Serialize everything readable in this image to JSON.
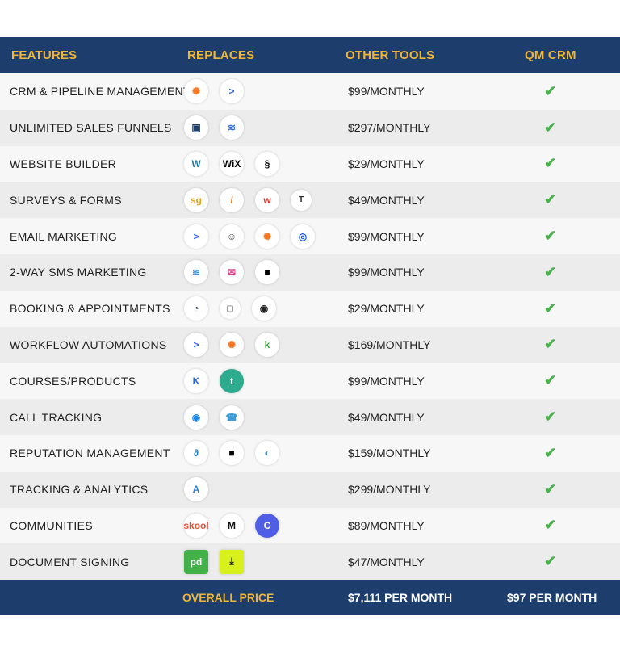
{
  "header": {
    "features": "FEATURES",
    "replaces": "REPLACES",
    "other_tools": "OTHER TOOLS",
    "qm_crm": "QM CRM"
  },
  "colors": {
    "navy": "#1d3d6c",
    "gold": "#f2b632",
    "check": "#4caf50"
  },
  "rows": [
    {
      "feature": "CRM & PIPELINE MANAGEMENT",
      "price": "$99/MONTHLY",
      "icons": [
        "hubspot-icon",
        "activecampaign-icon"
      ]
    },
    {
      "feature": "UNLIMITED SALES FUNNELS",
      "price": "$297/MONTHLY",
      "icons": [
        "clickfunnels-icon",
        "leadpages-icon"
      ]
    },
    {
      "feature": "WEBSITE BUILDER",
      "price": "$29/MONTHLY",
      "icons": [
        "wordpress-icon",
        "wix-icon",
        "squarespace-icon"
      ]
    },
    {
      "feature": "SURVEYS & FORMS",
      "price": "$49/MONTHLY",
      "icons": [
        "surveygizmo-icon",
        "jotform-icon",
        "wufoo-icon",
        "typeform-icon"
      ]
    },
    {
      "feature": "EMAIL MARKETING",
      "price": "$99/MONTHLY",
      "icons": [
        "activecampaign-icon",
        "mailchimp-icon",
        "hubspot-icon",
        "constantcontact-icon"
      ]
    },
    {
      "feature": "2-WAY SMS MARKETING",
      "price": "$99/MONTHLY",
      "icons": [
        "eztexting-icon",
        "textmagic-icon",
        "podium-icon"
      ]
    },
    {
      "feature": "BOOKING & APPOINTMENTS",
      "price": "$29/MONTHLY",
      "icons": [
        "calendly-icon",
        "acuity-icon",
        "schedule-icon"
      ]
    },
    {
      "feature": "WORKFLOW AUTOMATIONS",
      "price": "$169/MONTHLY",
      "icons": [
        "activecampaign-icon",
        "hubspot-icon",
        "keap-icon"
      ]
    },
    {
      "feature": "COURSES/PRODUCTS",
      "price": "$99/MONTHLY",
      "icons": [
        "kajabi-icon",
        "teachable-icon"
      ]
    },
    {
      "feature": "CALL TRACKING",
      "price": "$49/MONTHLY",
      "icons": [
        "callrail-icon",
        "calltracking-icon"
      ]
    },
    {
      "feature": "REPUTATION MANAGEMENT",
      "price": "$159/MONTHLY",
      "icons": [
        "birdeye-icon",
        "podium-icon",
        "yext-icon"
      ]
    },
    {
      "feature": "TRACKING & ANALYTICS",
      "price": "$299/MONTHLY",
      "icons": [
        "analytics-icon"
      ]
    },
    {
      "feature": "COMMUNITIES",
      "price": "$89/MONTHLY",
      "icons": [
        "skool-icon",
        "mightynetworks-icon",
        "circle-icon"
      ]
    },
    {
      "feature": "DOCUMENT SIGNING",
      "price": "$47/MONTHLY",
      "icons": [
        "pandadoc-icon",
        "docusign-icon"
      ]
    }
  ],
  "check_mark": "✔",
  "footer": {
    "label": "OVERALL PRICE",
    "other_total": "$7,111 PER MONTH",
    "qm_total": "$97 PER MONTH"
  }
}
